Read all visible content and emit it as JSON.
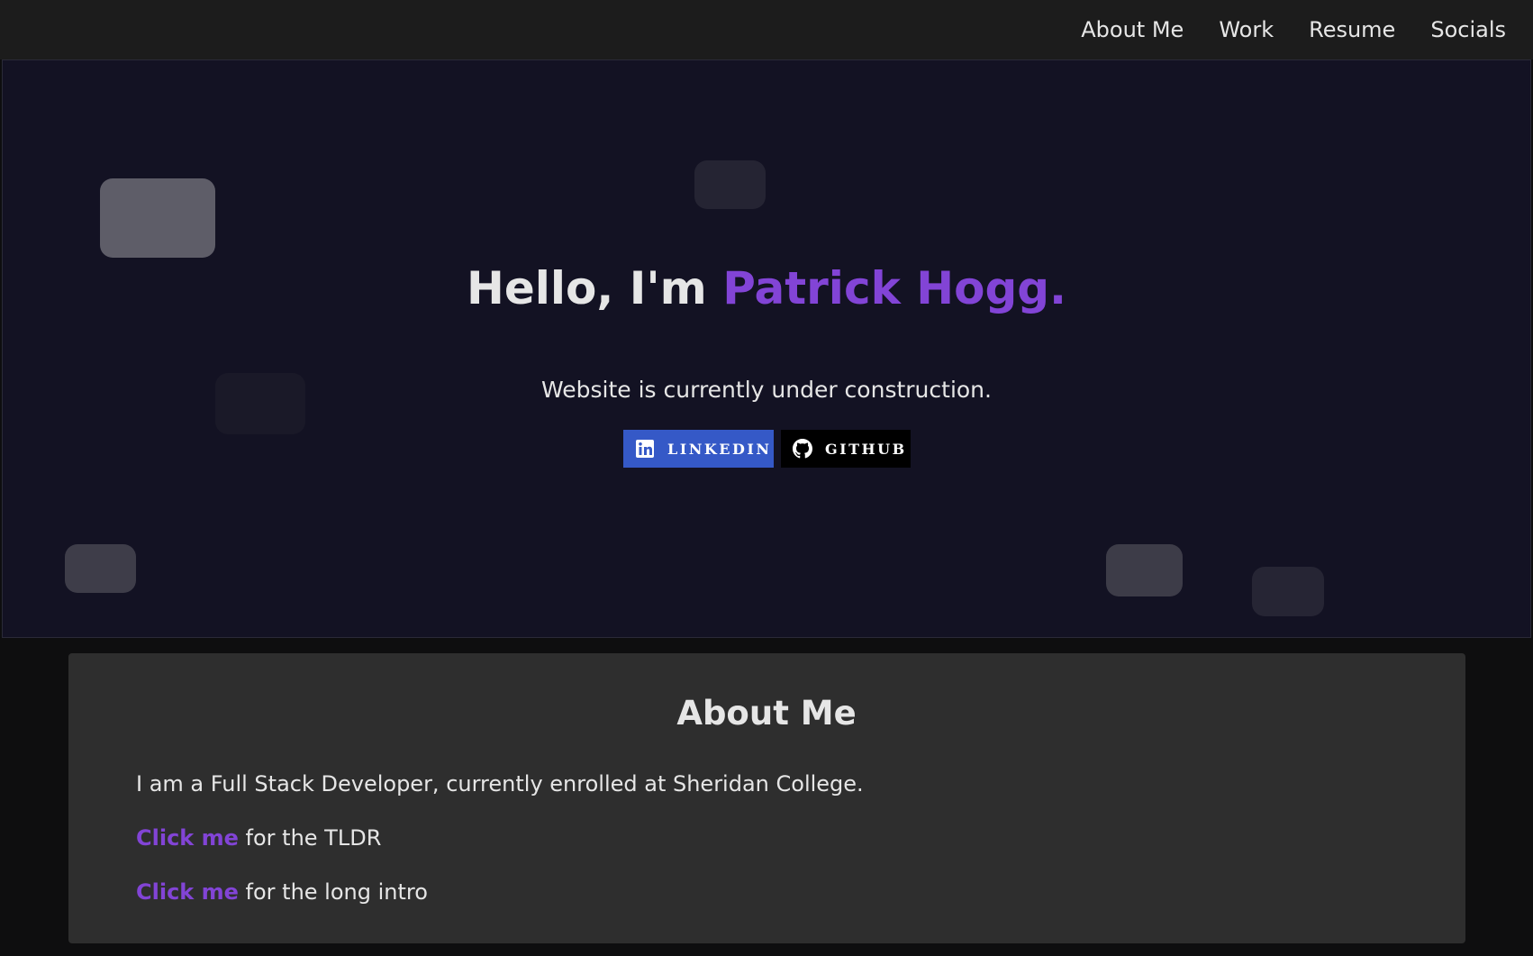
{
  "nav": {
    "items": [
      {
        "label": "About Me"
      },
      {
        "label": "Work"
      },
      {
        "label": "Resume"
      },
      {
        "label": "Socials"
      }
    ]
  },
  "hero": {
    "greeting": "Hello, I'm ",
    "name": "Patrick Hogg.",
    "subtitle": "Website is currently under construction.",
    "buttons": {
      "linkedin": {
        "label": "LINKEDIN",
        "icon": "linkedin-icon",
        "color": "#3559c7"
      },
      "github": {
        "label": "GITHUB",
        "icon": "github-icon",
        "color": "#000000"
      }
    }
  },
  "about": {
    "title": "About Me",
    "intro": "I am a Full Stack Developer, currently enrolled at Sheridan College.",
    "tldr": {
      "link": "Click me",
      "text": " for the TLDR"
    },
    "long": {
      "link": "Click me",
      "text": " for the long intro"
    }
  },
  "colors": {
    "accent": "#8244d6",
    "hero_bg": "#131223",
    "nav_bg": "#1c1c1c",
    "card_bg": "#2e2e2e"
  }
}
